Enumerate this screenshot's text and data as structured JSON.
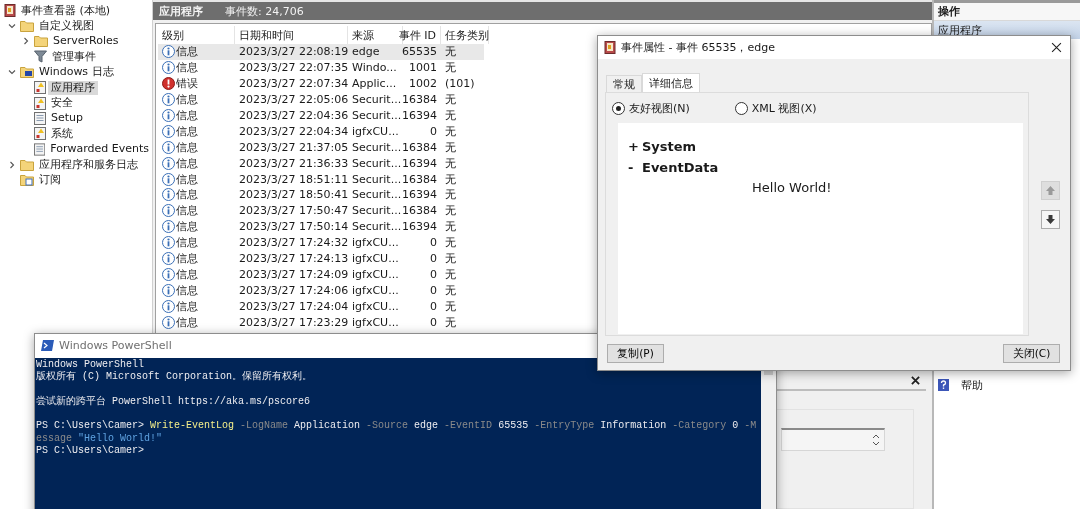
{
  "tree": [
    {
      "label": "事件查看器 (本地)",
      "kind": "viewer",
      "selected": false,
      "children": [
        {
          "label": "自定义视图",
          "kind": "folder",
          "expanded": true,
          "selected": false,
          "children": [
            {
              "label": "ServerRoles",
              "kind": "folder",
              "expanded": false,
              "selected": false
            },
            {
              "label": "管理事件",
              "kind": "filter",
              "selected": false
            }
          ]
        },
        {
          "label": "Windows 日志",
          "kind": "folder-log",
          "expanded": true,
          "selected": false,
          "children": [
            {
              "label": "应用程序",
              "kind": "log-alert",
              "selected": true
            },
            {
              "label": "安全",
              "kind": "log-alert",
              "selected": false
            },
            {
              "label": "Setup",
              "kind": "log",
              "selected": false
            },
            {
              "label": "系统",
              "kind": "log-alert",
              "selected": false
            },
            {
              "label": "Forwarded Events",
              "kind": "log",
              "selected": false
            }
          ]
        },
        {
          "label": "应用程序和服务日志",
          "kind": "folder",
          "expanded": false,
          "selected": false
        },
        {
          "label": "订阅",
          "kind": "subscription",
          "selected": false
        }
      ]
    }
  ],
  "log_header": {
    "name": "应用程序",
    "count": "事件数: 24,706"
  },
  "table": {
    "columns": [
      "级别",
      "日期和时间",
      "来源",
      "事件 ID",
      "任务类别"
    ],
    "rows": [
      {
        "kind": "info",
        "level": "信息",
        "time": "2023/3/27 22:08:19",
        "source": "edge",
        "id": "65535",
        "category": "无",
        "selected": true
      },
      {
        "kind": "info",
        "level": "信息",
        "time": "2023/3/27 22:07:35",
        "source": "Windo...",
        "id": "1001",
        "category": "无",
        "selected": false
      },
      {
        "kind": "error",
        "level": "错误",
        "time": "2023/3/27 22:07:34",
        "source": "Applic...",
        "id": "1002",
        "category": "(101)",
        "selected": false
      },
      {
        "kind": "info",
        "level": "信息",
        "time": "2023/3/27 22:05:06",
        "source": "Securit...",
        "id": "16384",
        "category": "无",
        "selected": false
      },
      {
        "kind": "info",
        "level": "信息",
        "time": "2023/3/27 22:04:36",
        "source": "Securit...",
        "id": "16394",
        "category": "无",
        "selected": false
      },
      {
        "kind": "info",
        "level": "信息",
        "time": "2023/3/27 22:04:34",
        "source": "igfxCU...",
        "id": "0",
        "category": "无",
        "selected": false
      },
      {
        "kind": "info",
        "level": "信息",
        "time": "2023/3/27 21:37:05",
        "source": "Securit...",
        "id": "16384",
        "category": "无",
        "selected": false
      },
      {
        "kind": "info",
        "level": "信息",
        "time": "2023/3/27 21:36:33",
        "source": "Securit...",
        "id": "16394",
        "category": "无",
        "selected": false
      },
      {
        "kind": "info",
        "level": "信息",
        "time": "2023/3/27 18:51:11",
        "source": "Securit...",
        "id": "16384",
        "category": "无",
        "selected": false
      },
      {
        "kind": "info",
        "level": "信息",
        "time": "2023/3/27 18:50:41",
        "source": "Securit...",
        "id": "16394",
        "category": "无",
        "selected": false
      },
      {
        "kind": "info",
        "level": "信息",
        "time": "2023/3/27 17:50:47",
        "source": "Securit...",
        "id": "16384",
        "category": "无",
        "selected": false
      },
      {
        "kind": "info",
        "level": "信息",
        "time": "2023/3/27 17:50:14",
        "source": "Securit...",
        "id": "16394",
        "category": "无",
        "selected": false
      },
      {
        "kind": "info",
        "level": "信息",
        "time": "2023/3/27 17:24:32",
        "source": "igfxCU...",
        "id": "0",
        "category": "无",
        "selected": false
      },
      {
        "kind": "info",
        "level": "信息",
        "time": "2023/3/27 17:24:13",
        "source": "igfxCU...",
        "id": "0",
        "category": "无",
        "selected": false
      },
      {
        "kind": "info",
        "level": "信息",
        "time": "2023/3/27 17:24:09",
        "source": "igfxCU...",
        "id": "0",
        "category": "无",
        "selected": false
      },
      {
        "kind": "info",
        "level": "信息",
        "time": "2023/3/27 17:24:06",
        "source": "igfxCU...",
        "id": "0",
        "category": "无",
        "selected": false
      },
      {
        "kind": "info",
        "level": "信息",
        "time": "2023/3/27 17:24:04",
        "source": "igfxCU...",
        "id": "0",
        "category": "无",
        "selected": false
      },
      {
        "kind": "info",
        "level": "信息",
        "time": "2023/3/27 17:23:29",
        "source": "igfxCU...",
        "id": "0",
        "category": "无",
        "selected": false
      }
    ]
  },
  "actions": {
    "title": "操作",
    "section": "应用程序",
    "items": [
      {
        "label": "帮助",
        "kind": "help"
      }
    ]
  },
  "dialog": {
    "title": "事件属性 - 事件 65535，edge",
    "tabs": [
      {
        "label": "常规",
        "selected": false
      },
      {
        "label": "详细信息",
        "selected": true
      }
    ],
    "views": [
      {
        "label": "友好视图(N)",
        "selected": true
      },
      {
        "label": "XML 视图(X)",
        "selected": false
      }
    ],
    "nodes": [
      {
        "toggle": "+",
        "label": "System"
      },
      {
        "toggle": "-",
        "label": "EventData",
        "value": "Hello World!"
      }
    ],
    "nav": [
      {
        "kind": "up",
        "disabled": true
      },
      {
        "kind": "down",
        "disabled": false
      }
    ],
    "buttons": [
      "复制(P)",
      "关闭(C)"
    ]
  },
  "powershell": {
    "title": "Windows PowerShell",
    "blocks": [
      [
        [
          {
            "kind": "plain",
            "text": "Windows PowerShell"
          }
        ],
        [
          {
            "kind": "plain",
            "text": "版权所有 (C) Microsoft Corporation。保留所有权利。"
          }
        ]
      ],
      [
        [
          {
            "kind": "plain",
            "text": "尝试新的跨平台 PowerShell https://aka.ms/pscore6"
          }
        ]
      ],
      [
        [
          {
            "kind": "plain",
            "text": "PS C:\\Users\\Camer> "
          },
          {
            "kind": "command",
            "text": "Write-EventLog"
          },
          {
            "kind": "param",
            "text": " -LogName"
          },
          {
            "kind": "plain",
            "text": " Application"
          },
          {
            "kind": "param",
            "text": " -Source"
          },
          {
            "kind": "plain",
            "text": " edge"
          },
          {
            "kind": "param",
            "text": " -EventID"
          },
          {
            "kind": "plain",
            "text": " 65535"
          },
          {
            "kind": "param",
            "text": " -EntryType"
          },
          {
            "kind": "plain",
            "text": " Information"
          },
          {
            "kind": "param",
            "text": " -Category"
          },
          {
            "kind": "plain",
            "text": " 0"
          },
          {
            "kind": "param",
            "text": " -M"
          }
        ],
        [
          {
            "kind": "param",
            "text": "essage"
          },
          {
            "kind": "string",
            "text": " \"Hello World!\""
          }
        ],
        [
          {
            "kind": "plain",
            "text": "PS C:\\Users\\Camer>"
          }
        ]
      ]
    ]
  }
}
